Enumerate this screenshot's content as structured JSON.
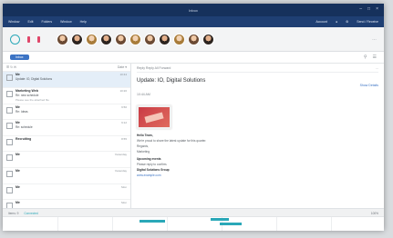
{
  "window": {
    "title": "Inbox",
    "controls": [
      "–",
      "□",
      "×"
    ]
  },
  "menu": {
    "items": [
      "Window",
      "Edit",
      "Folders",
      "Window",
      "Help"
    ],
    "right_items": [
      "Account",
      "●",
      "⚙",
      "Send / Receive"
    ]
  },
  "people": {
    "more": "…",
    "count": 11
  },
  "search": {
    "folder": "Inbox",
    "placeholder": ""
  },
  "list_toolbar": {
    "left": "☰  ↻  ✉",
    "right": "Date ▾"
  },
  "messages": [
    {
      "sender": "Me",
      "subject": "Update: IO, Digital Solutions",
      "preview": "",
      "time": "10:44"
    },
    {
      "sender": "Marketing Web",
      "subject": "Re: new schedule",
      "preview": "Please see the attached file",
      "time": "10:20"
    },
    {
      "sender": "Me",
      "subject": "Re: Ideas",
      "preview": "",
      "time": "9:50"
    },
    {
      "sender": "Me",
      "subject": "Re: schedule",
      "preview": "",
      "time": "9:12"
    },
    {
      "sender": "Recruiting",
      "subject": "",
      "preview": "",
      "time": "8:55"
    },
    {
      "sender": "Me",
      "subject": "",
      "preview": "",
      "time": "Yesterday"
    },
    {
      "sender": "Me",
      "subject": "",
      "preview": "",
      "time": "Yesterday"
    },
    {
      "sender": "Me",
      "subject": "",
      "preview": "",
      "time": "Mon"
    },
    {
      "sender": "Me",
      "subject": "",
      "preview": "",
      "time": "Mon"
    }
  ],
  "reader": {
    "toolbar_left": "Reply  Reply All  Forward",
    "toolbar_right": "…",
    "subject": "Update: IO, Digital Solutions",
    "from": "10:44 AM",
    "from_right": "Show Details",
    "lines": [
      {
        "text": "Hello Team,",
        "style": "bold"
      },
      {
        "text": "We're proud to share the latest update for this quarter.",
        "style": ""
      },
      {
        "text": "Regards,",
        "style": ""
      },
      {
        "text": "Marketing",
        "style": ""
      },
      {
        "text": "",
        "style": ""
      },
      {
        "text": "Upcoming events",
        "style": "bold"
      },
      {
        "text": "Please reply to confirm.",
        "style": ""
      },
      {
        "text": "Digital Solutions Group",
        "style": "bold"
      },
      {
        "text": "www.example.com",
        "style": "link"
      }
    ]
  },
  "status": {
    "left": "Items: 9",
    "link": "Connected",
    "right": "100%"
  }
}
